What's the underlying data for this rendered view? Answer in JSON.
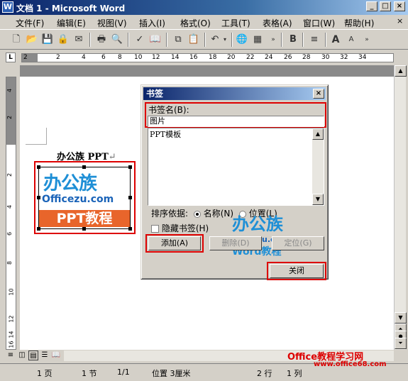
{
  "window": {
    "title": "文档 1 - Microsoft Word",
    "icon": "W"
  },
  "menu": [
    "文件(F)",
    "编辑(E)",
    "视图(V)",
    "插入(I)",
    "格式(O)",
    "工具(T)",
    "表格(A)",
    "窗口(W)",
    "帮助(H)"
  ],
  "menu_close": "×",
  "toolbar": {
    "bold": "B",
    "grow": "A",
    "shrink": "A"
  },
  "ruler": {
    "tab_stop": "L",
    "ticks": [
      "2",
      "2",
      "4",
      "6",
      "8",
      "10",
      "12",
      "14",
      "16",
      "18",
      "20",
      "22",
      "24",
      "26",
      "28",
      "30",
      "32",
      "34"
    ]
  },
  "vruler": {
    "ticks": [
      "4",
      "2",
      "2",
      "4",
      "6",
      "8",
      "10",
      "12",
      "14",
      "16"
    ]
  },
  "document": {
    "title": "办公族 PPT",
    "pilcrow": "↵"
  },
  "logo": {
    "line1": "办公族",
    "line2": "Officezu.com",
    "line3": "PPT教程"
  },
  "dialog": {
    "title": "书签",
    "name_label": "书签名(B):",
    "name_value": "图片",
    "list_items": [
      "PPT模板"
    ],
    "sort_label": "排序依据:",
    "sort_name": "名称(N)",
    "sort_position": "位置(L)",
    "hidden_label": "隐藏书签(H)",
    "add": "添加(A)",
    "delete": "删除(D)",
    "goto": "定位(G)",
    "close": "关闭",
    "watermark": {
      "a": "办公族",
      "b": "Officezu.com",
      "c": "Word教程"
    }
  },
  "status": {
    "page": "1 页",
    "section": "1 节",
    "pages": "1/1",
    "position": "位置 3厘米",
    "line": "2 行",
    "col": "1 列"
  },
  "site_watermark": {
    "title": "Office教程学习网",
    "url": "www.office68.com"
  }
}
